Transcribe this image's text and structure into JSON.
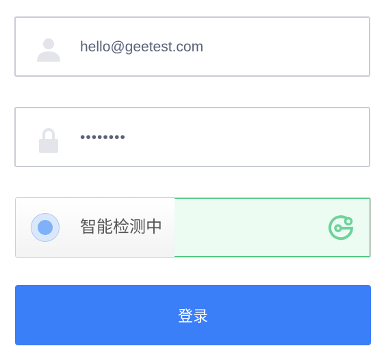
{
  "email_field": {
    "value": "hello@geetest.com",
    "icon": "user-icon"
  },
  "password_field": {
    "value": "••••••••",
    "icon": "lock-icon"
  },
  "captcha": {
    "status_text": "智能检测中",
    "logo_icon": "geetest-logo-icon",
    "accent": "#3fbf74"
  },
  "login_button": {
    "label": "登录",
    "color": "#3a7ef8"
  }
}
